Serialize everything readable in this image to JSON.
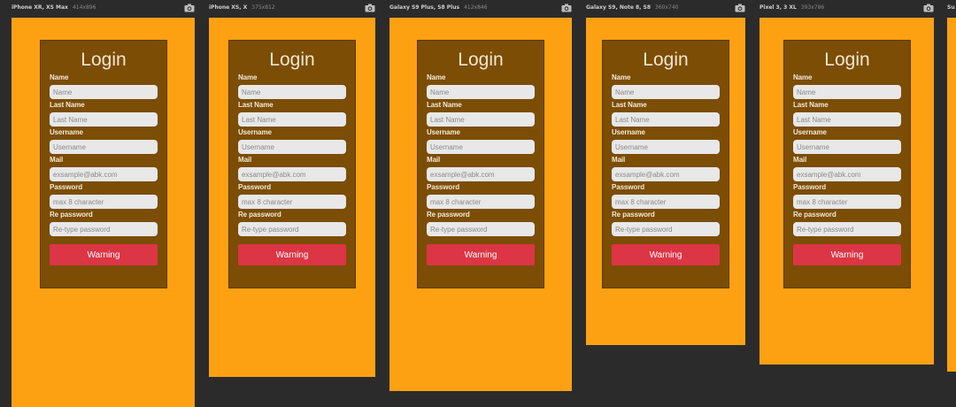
{
  "colors": {
    "page_background": "#2b2b2b",
    "screen_background": "#fda113",
    "card_background": "#7b4d05",
    "input_background": "#e8e8e8",
    "button_background": "#dc3545"
  },
  "icons": {
    "device_capture": "camera-icon"
  },
  "devices": [
    {
      "name": "iPhone XR, XS Max",
      "dims": "414x896"
    },
    {
      "name": "iPhone XS, X",
      "dims": "375x812"
    },
    {
      "name": "Galaxy S9 Plus, S8 Plus",
      "dims": "412x846"
    },
    {
      "name": "Galaxy S9, Note 8, S8",
      "dims": "360x740"
    },
    {
      "name": "Pixel 3, 3 XL",
      "dims": "393x786"
    },
    {
      "name": "Su",
      "dims": ""
    }
  ],
  "form": {
    "title": "Login",
    "fields": [
      {
        "label": "Name",
        "placeholder": "Name",
        "value": ""
      },
      {
        "label": "Last Name",
        "placeholder": "Last Name",
        "value": ""
      },
      {
        "label": "Username",
        "placeholder": "Username",
        "value": ""
      },
      {
        "label": "Mail",
        "placeholder": "exsample@abk.com",
        "value": ""
      },
      {
        "label": "Password",
        "placeholder": "max 8 character",
        "value": ""
      },
      {
        "label": "Re password",
        "placeholder": "Re-type password",
        "value": ""
      }
    ],
    "button_label": "Warning"
  }
}
